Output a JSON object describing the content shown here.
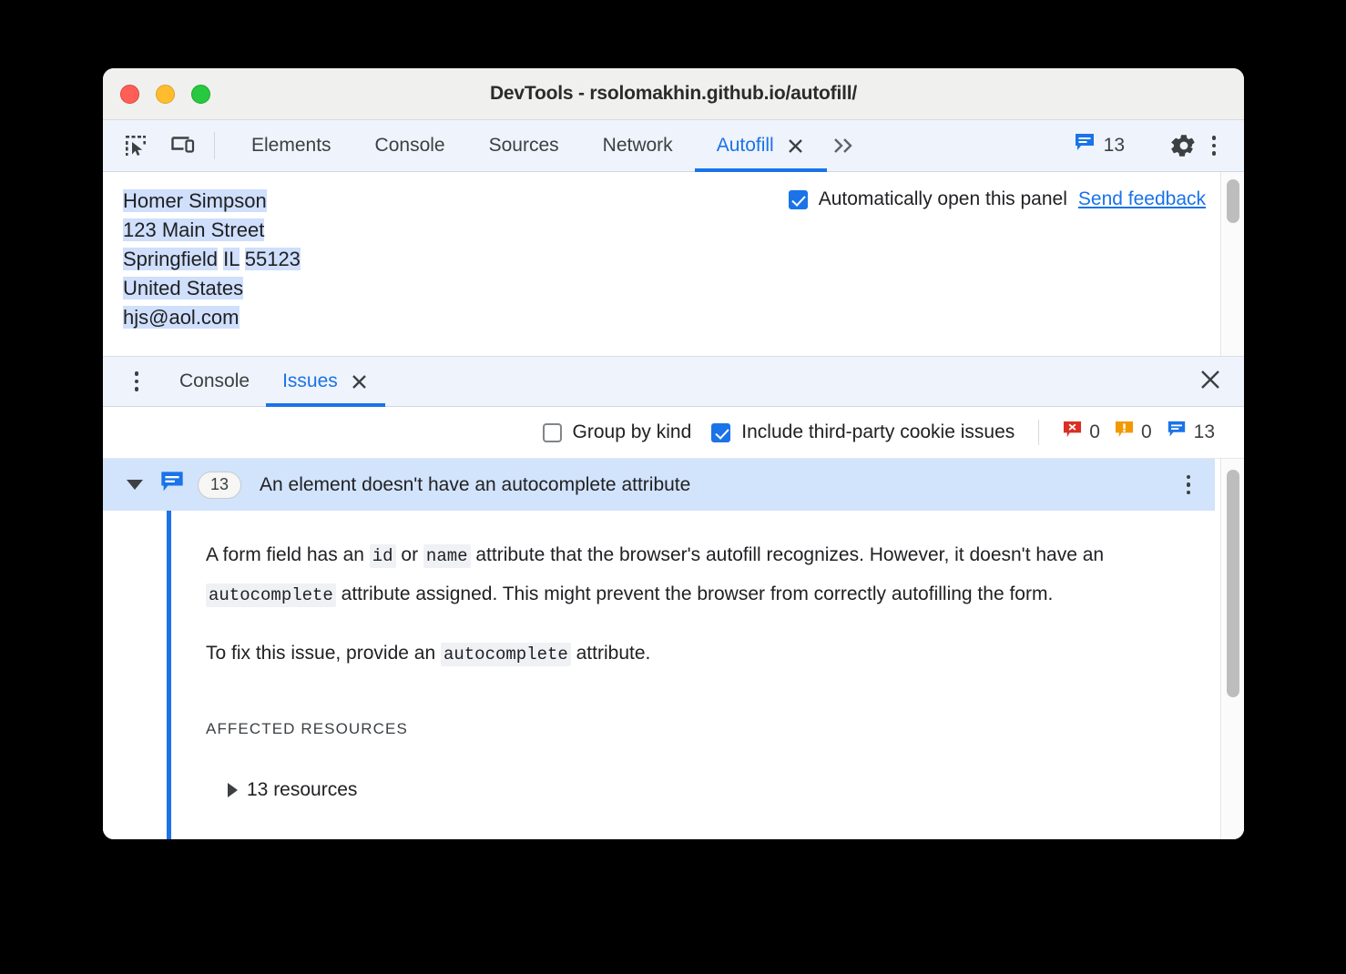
{
  "window": {
    "title": "DevTools - rsolomakhin.github.io/autofill/",
    "traffic_lights": [
      "close",
      "minimize",
      "zoom"
    ]
  },
  "toolbar": {
    "inspect_icon": "inspect-element-icon",
    "device_icon": "device-toolbar-icon",
    "tabs": [
      {
        "label": "Elements",
        "active": false,
        "closable": false
      },
      {
        "label": "Console",
        "active": false,
        "closable": false
      },
      {
        "label": "Sources",
        "active": false,
        "closable": false
      },
      {
        "label": "Network",
        "active": false,
        "closable": false
      },
      {
        "label": "Autofill",
        "active": true,
        "closable": true
      }
    ],
    "more_tabs_icon": "chevron-double-right-icon",
    "issues_count": "13",
    "issues_icon": "issue-bubble-icon",
    "settings_icon": "gear-icon",
    "main_menu_icon": "kebab-menu-icon"
  },
  "autofill": {
    "address_lines": [
      [
        {
          "text": "Homer Simpson",
          "highlighted": true
        }
      ],
      [
        {
          "text": "123 Main Street",
          "highlighted": true
        }
      ],
      [
        {
          "text": "Springfield",
          "highlighted": true
        },
        {
          "text": " ",
          "highlighted": false
        },
        {
          "text": "IL",
          "highlighted": true
        },
        {
          "text": " ",
          "highlighted": false
        },
        {
          "text": "55123",
          "highlighted": true
        }
      ],
      [
        {
          "text": "United States",
          "highlighted": true
        }
      ],
      [
        {
          "text": "hjs@aol.com",
          "highlighted": true
        }
      ]
    ],
    "auto_open_label": "Automatically open this panel",
    "auto_open_checked": true,
    "send_feedback_label": "Send feedback"
  },
  "drawer": {
    "menu_icon": "kebab-menu-icon",
    "tabs": [
      {
        "label": "Console",
        "active": false,
        "closable": false
      },
      {
        "label": "Issues",
        "active": true,
        "closable": true
      }
    ],
    "close_icon": "close-icon"
  },
  "filters": {
    "group_by_kind_label": "Group by kind",
    "group_by_kind_checked": false,
    "third_party_label": "Include third-party cookie issues",
    "third_party_checked": true,
    "counts": {
      "errors": "0",
      "warnings": "0",
      "issues": "13"
    }
  },
  "issue": {
    "expanded": true,
    "badge_count": "13",
    "title": "An element doesn't have an autocomplete attribute",
    "kebab_icon": "kebab-menu-icon",
    "paragraph1_a": "A form field has an ",
    "paragraph1_code1": "id",
    "paragraph1_b": " or ",
    "paragraph1_code2": "name",
    "paragraph1_c": " attribute that the browser's autofill recognizes. However, it doesn't have an ",
    "paragraph1_code3": "autocomplete",
    "paragraph1_d": " attribute assigned. This might prevent the browser from correctly autofilling the form.",
    "paragraph2_a": "To fix this issue, provide an ",
    "paragraph2_code1": "autocomplete",
    "paragraph2_b": " attribute.",
    "affected_resources_heading": "AFFECTED RESOURCES",
    "resources_label": "13 resources"
  },
  "colors": {
    "accent_blue": "#1a73e8",
    "selection_blue": "#cfdffc",
    "row_selected_blue": "#d2e3fc",
    "error_red": "#d93025",
    "warning_orange": "#f29900",
    "toolbar_bg": "#eff3fb"
  }
}
